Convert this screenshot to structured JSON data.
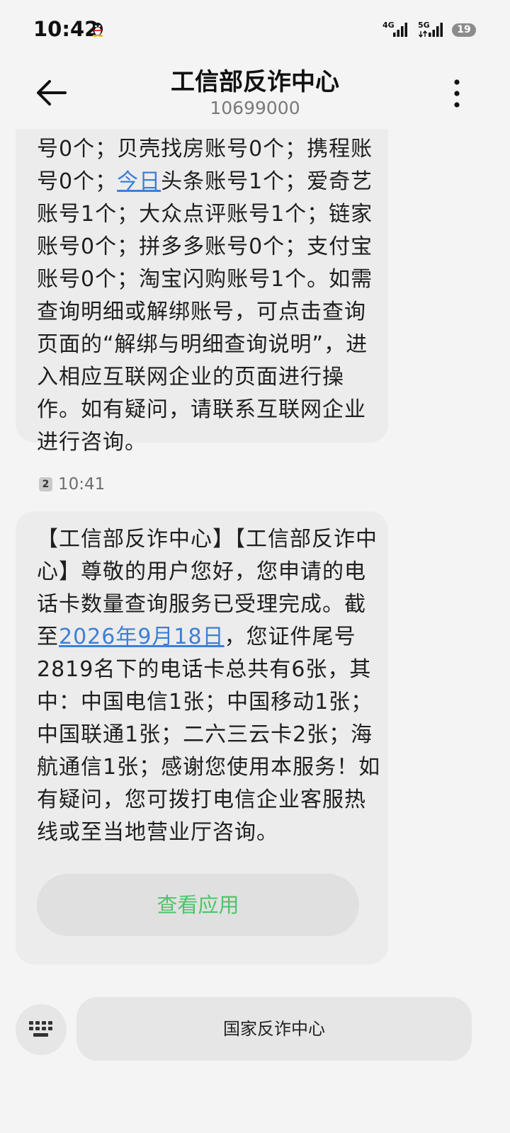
{
  "status": {
    "time": "10:42",
    "battery": "19",
    "net1": "4G",
    "net2": "5G"
  },
  "header": {
    "title": "工信部反诈中心",
    "number": "10699000"
  },
  "message1": {
    "p1": "号0个；贝壳找房账号0个；携程账号0个；",
    "link": "今日",
    "p2": "头条账号1个；爱奇艺账号1个；大众点评账号1个；链家账号0个；拼多多账号0个；支付宝账号0个；淘宝闪购账号1个。如需查询明细或解绑账号，可点击查询页面的“解绑与明细查询说明”，进入相应互联网企业的页面进行操作。如有疑问，请联系互联网企业进行咨询。"
  },
  "timestamp": {
    "sim": "2",
    "time": "10:41"
  },
  "message2": {
    "p1": "【工信部反诈中心】【工信部反诈中心】尊敬的用户您好，您申请的电话卡数量查询服务已受理完成。截至",
    "link": "2026年9月18日",
    "p2": "，您证件尾号2819名下的电话卡总共有6张，其中：中国电信1张；中国移动1张；中国联通1张；二六三云卡2张；海航通信1张；感谢您使用本服务！如有疑问，您可拨打电信企业客服热线或至当地营业厅咨询。",
    "button": "查看应用"
  },
  "bottom": {
    "quick_reply": "国家反诈中心"
  },
  "colors": {
    "link": "#3d7fd6",
    "app_button_text": "#4cc46a",
    "bubble": "#ececec",
    "background": "#f4f4f4"
  },
  "icons": [
    "qq-penguin-icon",
    "signal-4g-icon",
    "signal-5g-icon",
    "battery-icon",
    "back-arrow-icon",
    "more-vertical-icon",
    "sim-2-icon",
    "keyboard-icon"
  ]
}
